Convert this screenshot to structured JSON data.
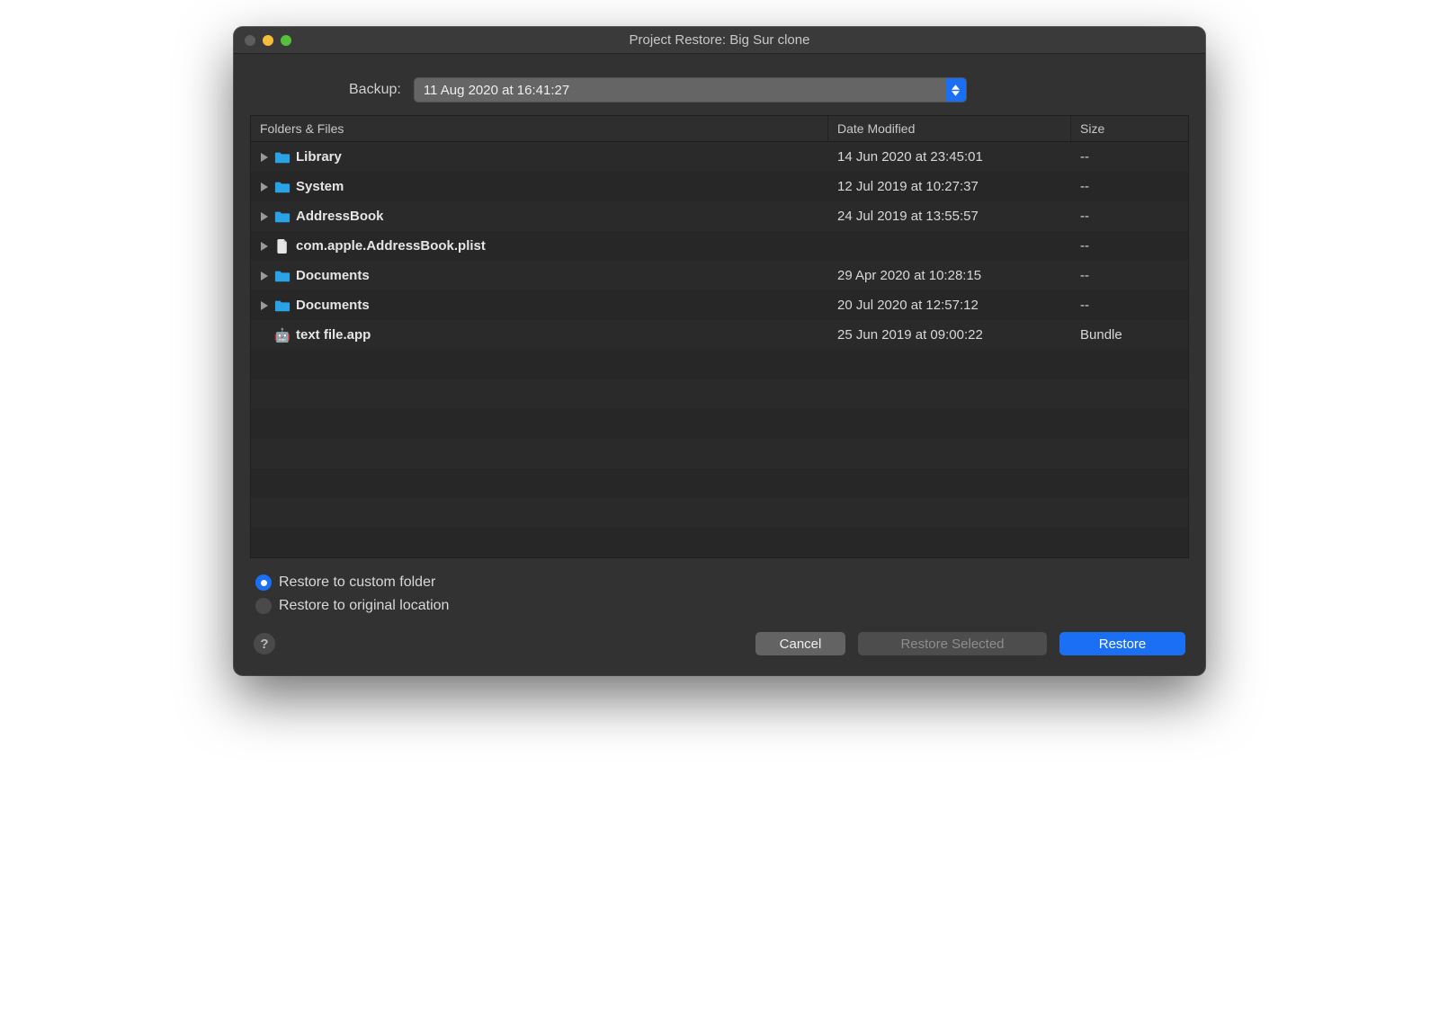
{
  "window": {
    "title": "Project Restore: Big Sur clone"
  },
  "backup": {
    "label": "Backup:",
    "selected": "11 Aug 2020 at 16:41:27"
  },
  "columns": {
    "name": "Folders & Files",
    "date": "Date Modified",
    "size": "Size"
  },
  "rows": [
    {
      "name": "Library",
      "date": "14 Jun 2020 at 23:45:01",
      "size": "--",
      "icon": "folder",
      "expandable": true
    },
    {
      "name": "System",
      "date": "12 Jul 2019 at 10:27:37",
      "size": "--",
      "icon": "folder",
      "expandable": true
    },
    {
      "name": "AddressBook",
      "date": "24 Jul 2019 at 13:55:57",
      "size": "--",
      "icon": "folder",
      "expandable": true
    },
    {
      "name": "com.apple.AddressBook.plist",
      "date": "",
      "size": "--",
      "icon": "file",
      "expandable": true
    },
    {
      "name": "Documents",
      "date": "29 Apr 2020 at 10:28:15",
      "size": "--",
      "icon": "folder",
      "expandable": true
    },
    {
      "name": "Documents",
      "date": "20 Jul 2020 at 12:57:12",
      "size": "--",
      "icon": "folder",
      "expandable": true
    },
    {
      "name": "text file.app",
      "date": "25 Jun 2019 at 09:00:22",
      "size": "Bundle",
      "icon": "app",
      "expandable": false
    }
  ],
  "blank_rows": 7,
  "options": {
    "custom": "Restore to custom folder",
    "original": "Restore to original location",
    "selected": "custom"
  },
  "buttons": {
    "help": "?",
    "cancel": "Cancel",
    "restore_selected": "Restore Selected",
    "restore": "Restore"
  }
}
